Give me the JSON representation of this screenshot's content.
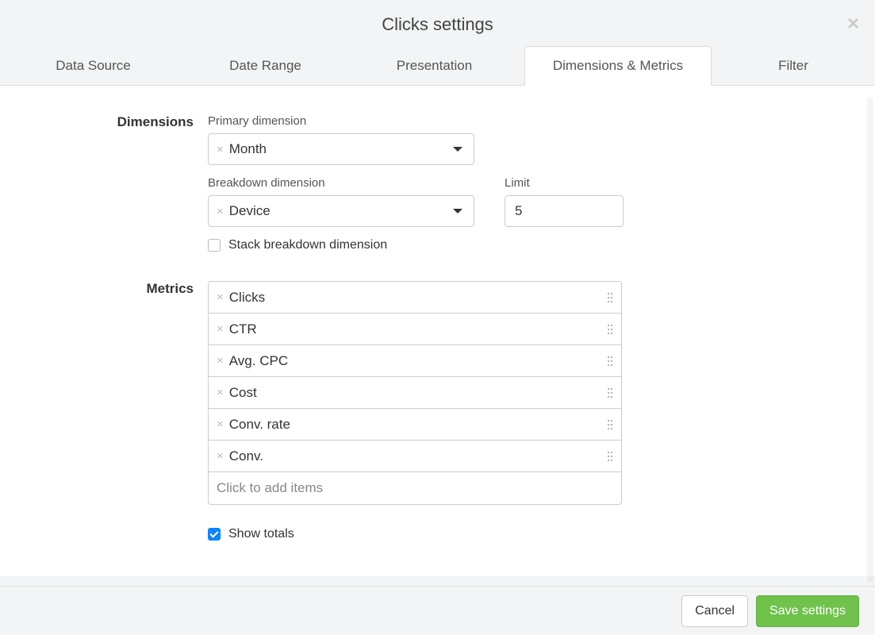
{
  "modal": {
    "title": "Clicks settings"
  },
  "tabs": [
    {
      "label": "Data Source"
    },
    {
      "label": "Date Range"
    },
    {
      "label": "Presentation"
    },
    {
      "label": "Dimensions & Metrics"
    },
    {
      "label": "Filter"
    }
  ],
  "dimensions": {
    "section_label": "Dimensions",
    "primary_label": "Primary dimension",
    "primary_value": "Month",
    "breakdown_label": "Breakdown dimension",
    "breakdown_value": "Device",
    "limit_label": "Limit",
    "limit_value": "5",
    "stack_label": "Stack breakdown dimension"
  },
  "metrics": {
    "section_label": "Metrics",
    "items": [
      {
        "name": "Clicks"
      },
      {
        "name": "CTR"
      },
      {
        "name": "Avg. CPC"
      },
      {
        "name": "Cost"
      },
      {
        "name": "Conv. rate"
      },
      {
        "name": "Conv."
      }
    ],
    "add_placeholder": "Click to add items",
    "show_totals_label": "Show totals"
  },
  "footer": {
    "cancel": "Cancel",
    "save": "Save settings"
  }
}
